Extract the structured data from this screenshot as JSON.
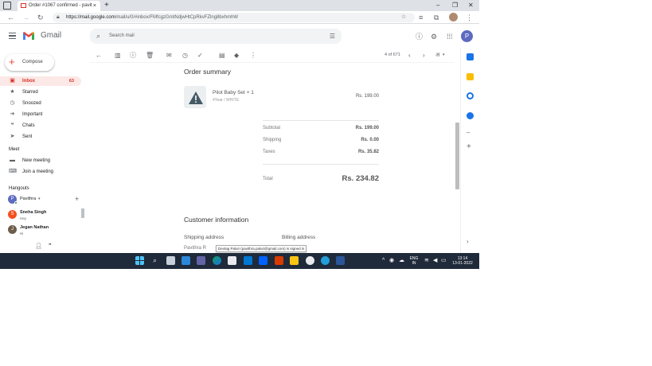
{
  "browser": {
    "tab_title": "Order #1067 confirmed - pavith",
    "tab_close": "×",
    "new_tab": "+",
    "url_host": "https://mail.google.com",
    "url_path": "/mail/u/0/#inbox/FMfcgzGmtNdjwHtCpRkvFZlng8bxhmhW",
    "win_minimize": "–",
    "win_maximize": "❐",
    "win_close": "✕"
  },
  "gmail": {
    "app_name": "Gmail",
    "search_placeholder": "Search mail",
    "account_initial": "P"
  },
  "nav": {
    "compose_label": "Compose",
    "items": [
      {
        "label": "Inbox",
        "count": "63"
      },
      {
        "label": "Starred"
      },
      {
        "label": "Snoozed"
      },
      {
        "label": "Important"
      },
      {
        "label": "Chats"
      },
      {
        "label": "Sent"
      }
    ],
    "meet_header": "Meet",
    "meet_items": [
      {
        "label": "New meeting"
      },
      {
        "label": "Join a meeting"
      }
    ],
    "hangouts_header": "Hangouts",
    "hangouts_user": "Pavithra",
    "hangouts_user_initial": "P",
    "contacts": [
      {
        "name": "Sneha Singh",
        "status": "Hey",
        "initial": "S",
        "color": "#f4511e"
      },
      {
        "name": "Jegan Nathan",
        "status": "Hi",
        "initial": "J",
        "color": "#6d5d4b"
      }
    ]
  },
  "toolbar": {
    "page_count": "4 of 671",
    "lang": "अ"
  },
  "email": {
    "order_summary_heading": "Order summary",
    "product_name": "Pilot Baby Set × 1",
    "product_variant": "4Year / WHITE",
    "product_price": "Rs. 199.00",
    "subtotal_label": "Subtotal",
    "subtotal_value": "Rs. 199.00",
    "shipping_label": "Shipping",
    "shipping_value": "Rs. 0.00",
    "taxes_label": "Taxes",
    "taxes_value": "Rs. 35.82",
    "total_label": "Total",
    "total_value": "Rs. 234.82",
    "customer_info_heading": "Customer information",
    "shipping_address_label": "Shipping address",
    "billing_address_label": "Billing address",
    "shipping_name": "Pavithra R",
    "tooltip": "Devtag Paluri (pavithra.paluri@gmail.com) is signed in"
  },
  "taskbar": {
    "lang_line1": "ENG",
    "lang_line2": "IN",
    "time": "13:14",
    "date": "13-01-2022"
  },
  "colors": {
    "gmail_red": "#d93025",
    "inbox_active_bg": "#fce8e6",
    "taskbar_bg": "#1f2a3a"
  }
}
